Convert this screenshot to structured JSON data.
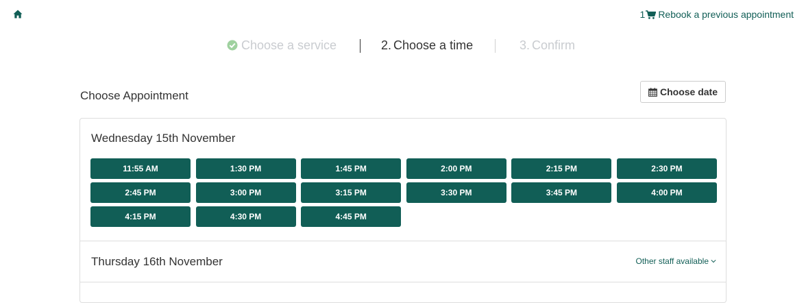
{
  "header": {
    "home_icon": "home-icon",
    "cart_count": "1",
    "cart_icon": "cart-icon",
    "rebook_label": "Rebook a previous appointment"
  },
  "steps": [
    {
      "label": "Choose a service",
      "state": "completed",
      "icon": "check-circle-icon"
    },
    {
      "number": "2.",
      "label": "Choose a time",
      "state": "active"
    },
    {
      "number": "3.",
      "label": "Confirm",
      "state": "upcoming"
    }
  ],
  "main": {
    "title": "Choose Appointment",
    "choose_date_label": "Choose date",
    "choose_date_icon": "calendar-icon"
  },
  "days": [
    {
      "title": "Wednesday 15th November",
      "slots": [
        "11:55 AM",
        "1:30 PM",
        "1:45 PM",
        "2:00 PM",
        "2:15 PM",
        "2:30 PM",
        "2:45 PM",
        "3:00 PM",
        "3:15 PM",
        "3:30 PM",
        "3:45 PM",
        "4:00 PM",
        "4:15 PM",
        "4:30 PM",
        "4:45 PM"
      ]
    },
    {
      "title": "Thursday 16th November",
      "other_staff_label": "Other staff available",
      "other_staff_icon": "chevron-down-icon"
    }
  ],
  "colors": {
    "accent": "#115e56",
    "step_inactive": "#c9ccd0",
    "check_green": "#9fd19f"
  }
}
